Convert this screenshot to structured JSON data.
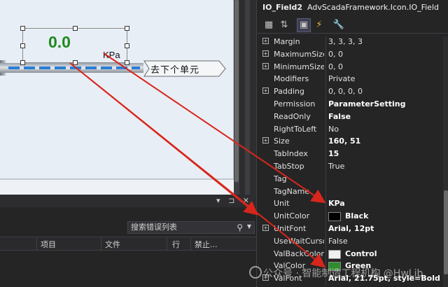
{
  "designer": {
    "io_field": {
      "value": "0.0",
      "unit": "KPa"
    },
    "next_cell_label": "去下个单元"
  },
  "error_panel": {
    "controls": "▾ ⊐ ✕",
    "search_placeholder": "搜索错误列表",
    "columns": [
      "",
      "项目",
      "文件",
      "行",
      "禁止..."
    ]
  },
  "properties": {
    "title_name": "IO_Field2",
    "title_type": "AdvScadaFramework.Icon.IO_Field",
    "rows": [
      {
        "expand": true,
        "name": "Margin",
        "value": "3, 3, 3, 3",
        "bold": false
      },
      {
        "expand": true,
        "name": "MaximumSize",
        "value": "0, 0",
        "bold": false
      },
      {
        "expand": true,
        "name": "MinimumSize",
        "value": "0, 0",
        "bold": false
      },
      {
        "expand": false,
        "name": "Modifiers",
        "value": "Private",
        "bold": false
      },
      {
        "expand": true,
        "name": "Padding",
        "value": "0, 0, 0, 0",
        "bold": false
      },
      {
        "expand": false,
        "name": "Permission",
        "value": "ParameterSetting",
        "bold": true
      },
      {
        "expand": false,
        "name": "ReadOnly",
        "value": "False",
        "bold": true
      },
      {
        "expand": false,
        "name": "RightToLeft",
        "value": "No",
        "bold": false
      },
      {
        "expand": true,
        "name": "Size",
        "value": "160, 51",
        "bold": true
      },
      {
        "expand": false,
        "name": "TabIndex",
        "value": "15",
        "bold": true
      },
      {
        "expand": false,
        "name": "TabStop",
        "value": "True",
        "bold": false
      },
      {
        "expand": false,
        "name": "Tag",
        "value": "",
        "bold": false
      },
      {
        "expand": false,
        "name": "TagName",
        "value": "",
        "bold": false
      },
      {
        "expand": false,
        "name": "Unit",
        "value": "KPa",
        "bold": true
      },
      {
        "expand": false,
        "name": "UnitColor",
        "value": "Black",
        "bold": true,
        "swatch": "#000000"
      },
      {
        "expand": true,
        "name": "UnitFont",
        "value": "Arial, 12pt",
        "bold": true
      },
      {
        "expand": false,
        "name": "UseWaitCursor",
        "value": "False",
        "bold": false
      },
      {
        "expand": false,
        "name": "ValBackColor",
        "value": "Control",
        "bold": true,
        "swatch": "#f0f0f0"
      },
      {
        "expand": false,
        "name": "ValColor",
        "value": "Green",
        "bold": true,
        "swatch": "#2e8b2e"
      },
      {
        "expand": true,
        "name": "ValFont",
        "value": "Arial, 21.75pt, style=Bold",
        "bold": true
      }
    ]
  },
  "watermark": "公众号 · 智能制造工程机构 @HwLib",
  "colors": {
    "arrow": "#d8261c",
    "value_green": "#1f8a1f",
    "pipe_flow": "#2a7fd6"
  }
}
